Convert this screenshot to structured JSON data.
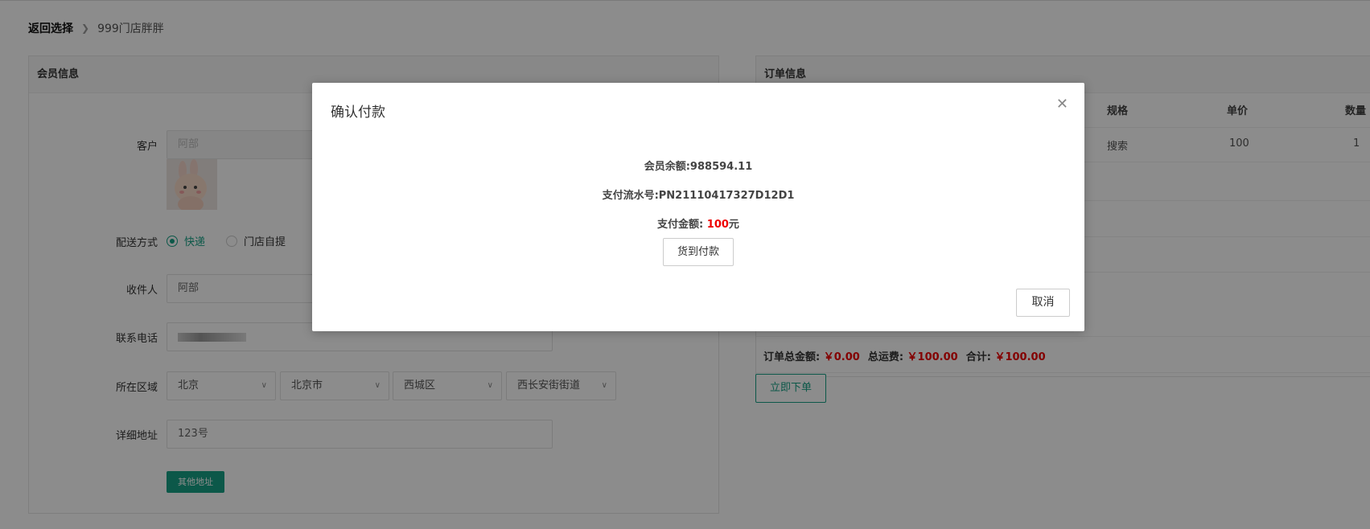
{
  "breadcrumb": {
    "back": "返回选择",
    "current": "999门店胖胖"
  },
  "member_panel": {
    "title": "会员信息",
    "customer_label": "客户",
    "customer_value": "阿部",
    "delivery_label": "配送方式",
    "delivery_options": [
      "快递",
      "门店自提"
    ],
    "delivery_selected": "快递",
    "receiver_label": "收件人",
    "receiver_value": "阿部",
    "phone_label": "联系电话",
    "region_label": "所在区域",
    "region": [
      "北京",
      "北京市",
      "西城区",
      "西长安街街道"
    ],
    "address_label": "详细地址",
    "address_value": "123号",
    "other_address_button": "其他地址"
  },
  "order_panel": {
    "title": "订单信息",
    "columns": [
      "规格",
      "单价",
      "数量"
    ],
    "row": [
      "搜索",
      "100",
      "1"
    ],
    "summary": {
      "total_label": "订单总金额:",
      "total_value": "￥0.00",
      "shipping_label": "总运费:",
      "shipping_value": "￥100.00",
      "sum_label": "合计:",
      "sum_value": "￥100.00"
    },
    "submit_button": "立即下单"
  },
  "modal": {
    "title": "确认付款",
    "balance": "会员余额:988594.11",
    "serial": "支付流水号:PN21110417327D12D1",
    "amount_label": "支付金额:",
    "amount_value": "100",
    "amount_unit": "元",
    "cod_button": "货到付款",
    "cancel_button": "取消"
  },
  "colors": {
    "accent": "#16a085",
    "price": "#ee0000"
  }
}
